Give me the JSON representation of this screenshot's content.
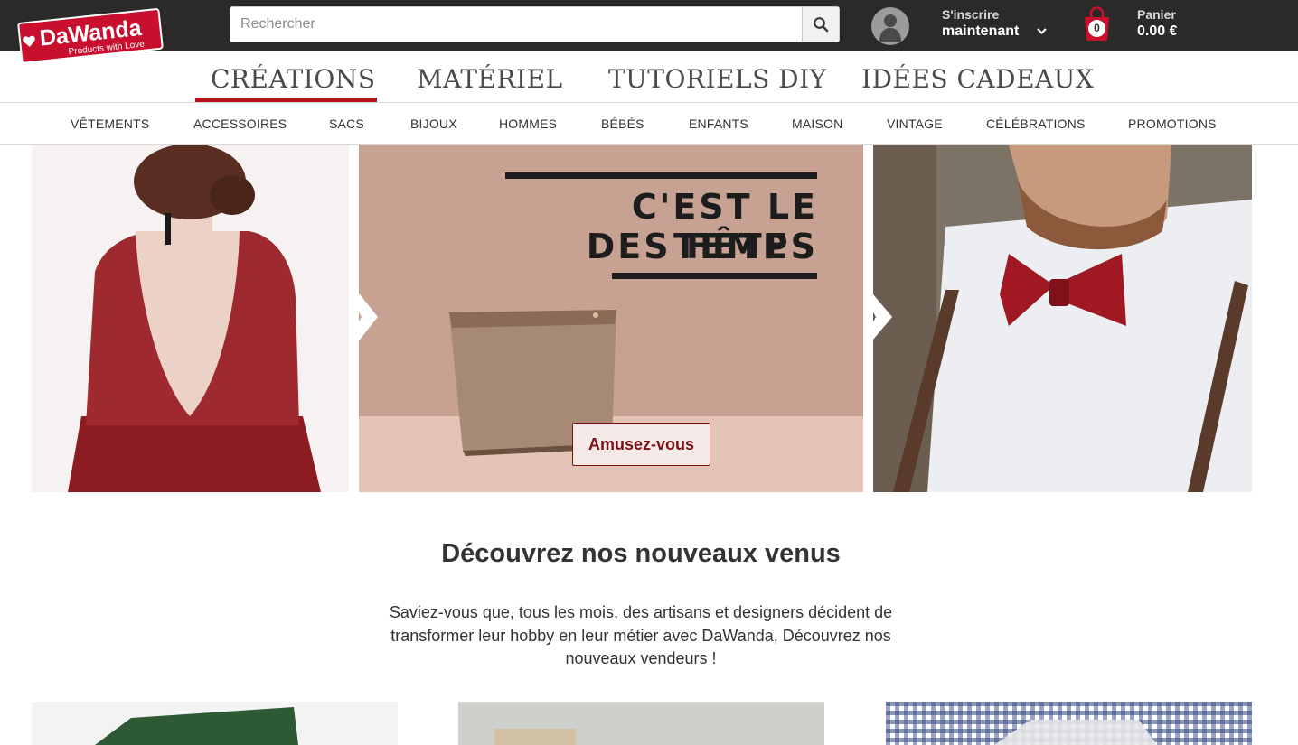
{
  "header": {
    "logo_text": "DaWanda",
    "logo_tagline": "Products with Love",
    "search": {
      "placeholder": "Rechercher"
    },
    "account": {
      "line1": "S'inscrire",
      "line2": "maintenant"
    },
    "cart": {
      "count": "0",
      "label": "Panier",
      "total": "0.00 €"
    },
    "colors": {
      "bar": "#2b2a28",
      "brand_red": "#c8102e"
    },
    "icons": {
      "search": "search-icon",
      "user": "user-icon",
      "chevron": "chevron-down-icon",
      "cart": "shopping-bag-icon"
    }
  },
  "main_nav": {
    "items": [
      {
        "label": "CRÉATIONS",
        "active": true
      },
      {
        "label": "MATÉRIEL",
        "active": false
      },
      {
        "label": "TUTORIELS DIY",
        "active": false
      },
      {
        "label": "IDÉES CADEAUX",
        "active": false
      }
    ],
    "active_color": "#b5121b"
  },
  "category_nav": {
    "items": [
      {
        "label": "VÊTEMENTS"
      },
      {
        "label": "ACCESSOIRES"
      },
      {
        "label": "SACS"
      },
      {
        "label": "BIJOUX"
      },
      {
        "label": "HOMMES"
      },
      {
        "label": "BÉBÉS"
      },
      {
        "label": "ENFANTS"
      },
      {
        "label": "MAISON"
      },
      {
        "label": "VINTAGE"
      },
      {
        "label": "CÉLÉBRATIONS"
      },
      {
        "label": "PROMOTIONS"
      }
    ]
  },
  "hero": {
    "title_line1": "C'EST LE TEMPS",
    "title_line2": "DES FÊTES",
    "button_label": "Amusez-vous",
    "button_color": "#7b1218"
  },
  "discover": {
    "title": "Découvrez nos nouveaux venus",
    "text": "Saviez-vous que, tous les mois, des artisans et designers décident de transformer leur hobby en leur métier avec DaWanda, Découvrez nos nouveaux vendeurs !"
  }
}
